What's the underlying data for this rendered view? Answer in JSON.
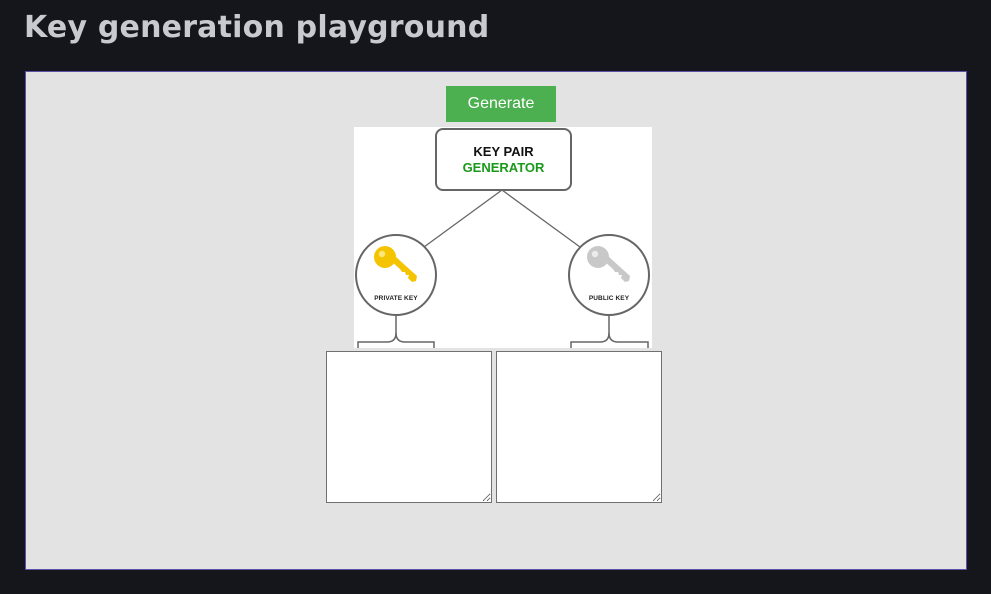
{
  "page": {
    "title": "Key generation playground"
  },
  "controls": {
    "generate_label": "Generate"
  },
  "diagram": {
    "generator_line1": "KEY PAIR",
    "generator_line2": "GENERATOR",
    "private_key_label": "PRIVATE KEY",
    "public_key_label": "PUBLIC KEY",
    "private_key_color": "#f5c400",
    "public_key_color": "#c8c8c8",
    "generator_text_color": "#1a9a1a"
  },
  "outputs": {
    "private_key_value": "",
    "public_key_value": ""
  },
  "colors": {
    "background": "#15151c",
    "panel": "#e3e3e3",
    "panel_border": "#5a52a8",
    "button": "#4caf50"
  }
}
